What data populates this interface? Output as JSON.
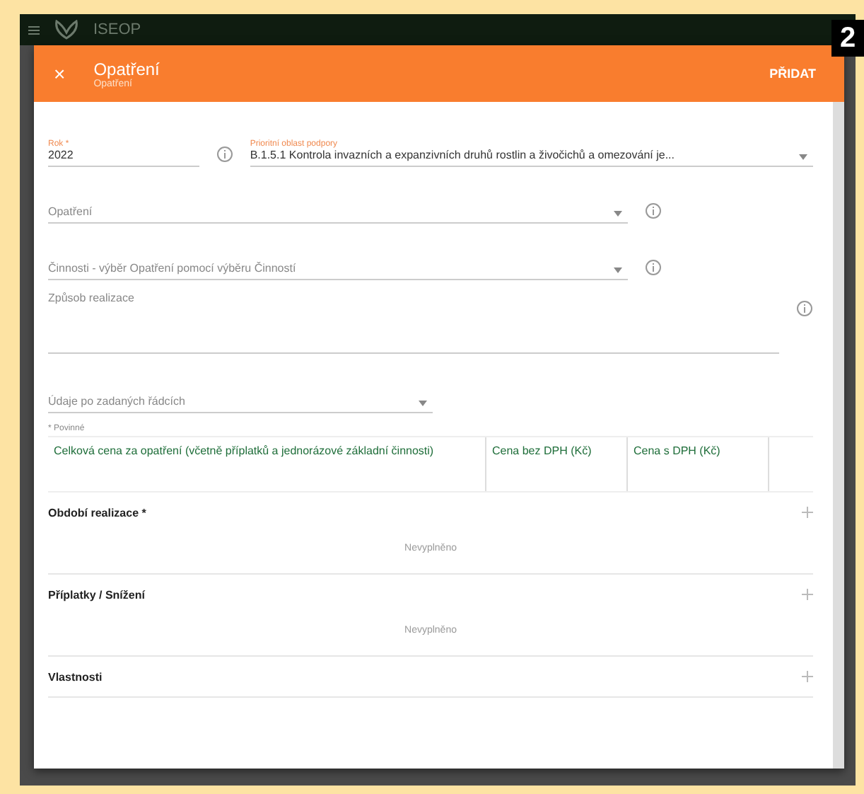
{
  "badge": "2",
  "app": {
    "title": "ISEOP"
  },
  "dialog": {
    "title": "Opatření",
    "subtitle": "Opatření",
    "close": "×",
    "action": "PŘIDAT"
  },
  "year": {
    "label": "Rok *",
    "value": "2022"
  },
  "area": {
    "label": "Prioritní oblast podpory",
    "value": "B.1.5.1 Kontrola invazních a expanzivních druhů rostlin a živočichů a omezování je..."
  },
  "fields": [
    {
      "placeholder": "Opatření",
      "kind": "select"
    },
    {
      "placeholder": "Činnosti - výběr Opatření pomocí výběru Činností",
      "kind": "select"
    },
    {
      "placeholder": "Způsob realizace",
      "kind": "text"
    }
  ],
  "rows_select": {
    "placeholder": "Údaje po zadaných řádcích"
  },
  "table": {
    "caption": "* Povinné",
    "columns": [
      "Celková cena za opatření (včetně příplatků a jednorázové základní činnosti)",
      "Cena bez DPH (Kč)",
      "Cena s DPH (Kč)"
    ]
  },
  "sections": [
    {
      "title": "Období realizace *",
      "empty": "Nevyplněno"
    },
    {
      "title": "Příplatky / Snížení",
      "empty": "Nevyplněno"
    },
    {
      "title": "Vlastnosti"
    }
  ]
}
